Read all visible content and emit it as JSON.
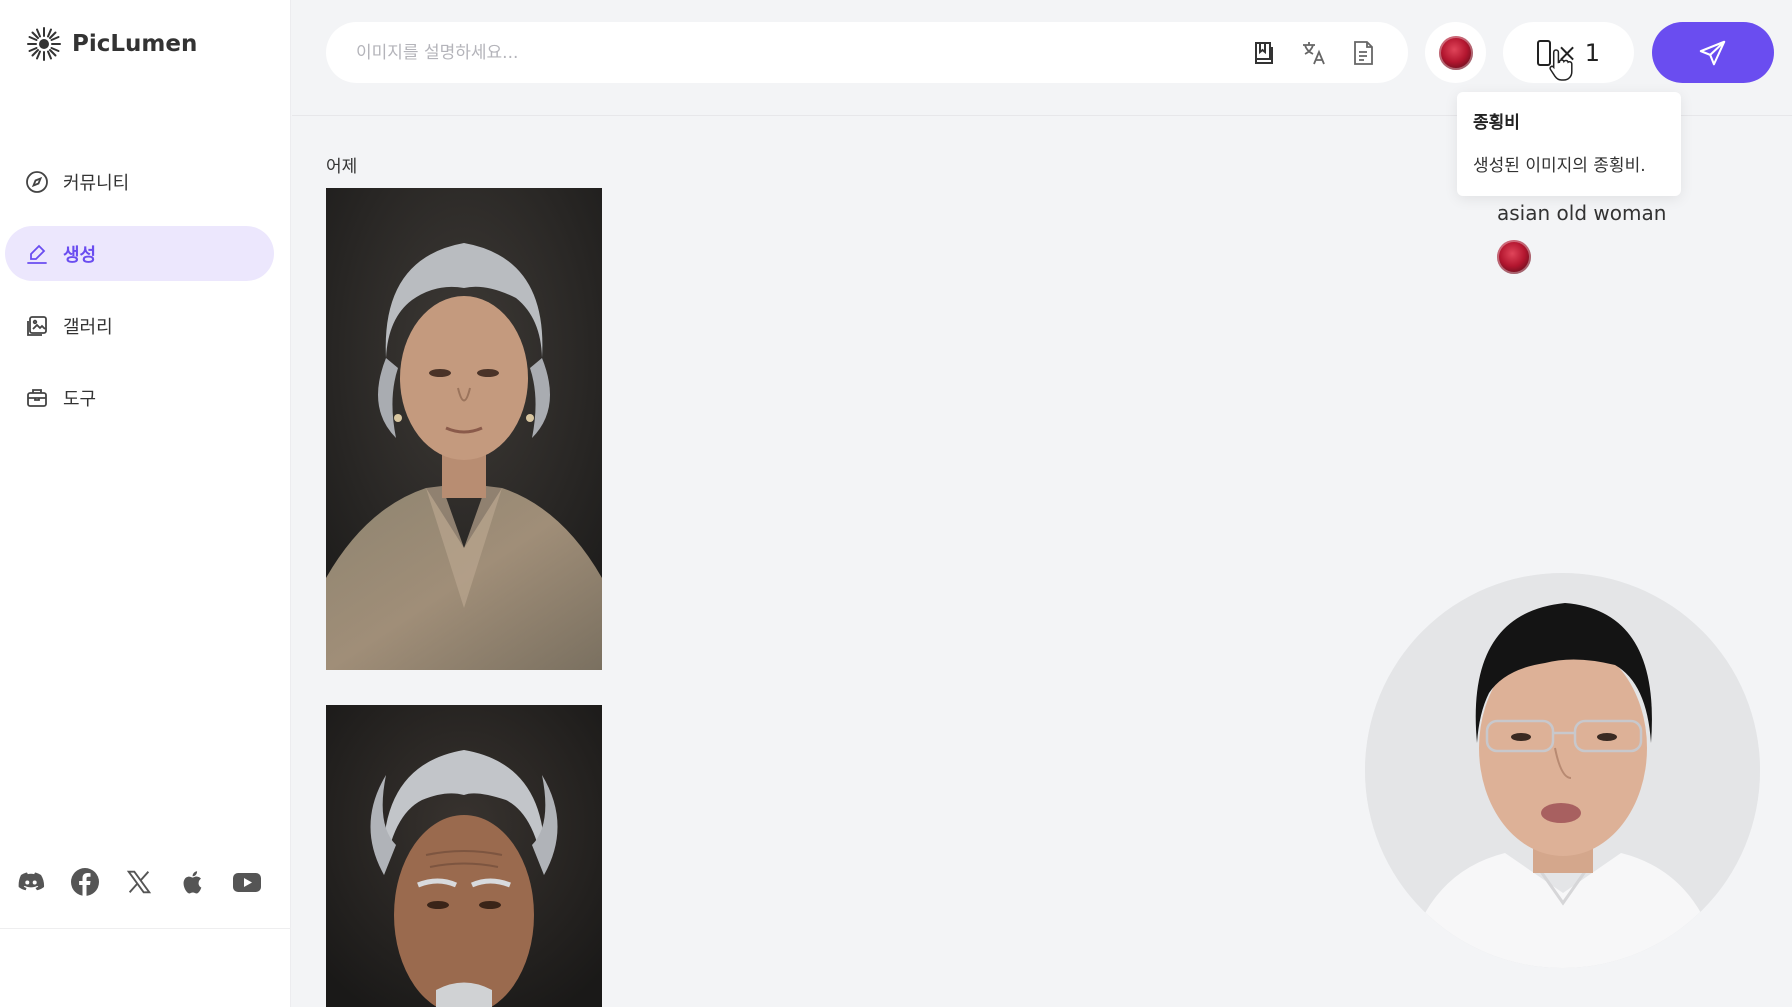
{
  "app": {
    "name": "PicLumen"
  },
  "sidebar": {
    "items": [
      {
        "label": "커뮤니티",
        "icon": "compass-icon",
        "active": false
      },
      {
        "label": "생성",
        "icon": "pen-icon",
        "active": true
      },
      {
        "label": "갤러리",
        "icon": "gallery-icon",
        "active": false
      },
      {
        "label": "도구",
        "icon": "toolbox-icon",
        "active": false
      }
    ],
    "socials": [
      "discord-icon",
      "facebook-icon",
      "x-icon",
      "apple-icon",
      "youtube-icon"
    ]
  },
  "search": {
    "placeholder": "이미지를 설명하세요...",
    "value": "",
    "tools": [
      "prompt-library-icon",
      "translate-icon",
      "document-icon"
    ]
  },
  "toolbar": {
    "ratio_count": "× 1"
  },
  "tooltip": {
    "title": "종횡비",
    "description": "생성된 이미지의 종횡비."
  },
  "feed": {
    "date_label": "어제",
    "prompt": "asian old woman"
  },
  "colors": {
    "accent": "#6a4df0",
    "active_bg": "#ece7fd",
    "background": "#f3f4f6"
  }
}
